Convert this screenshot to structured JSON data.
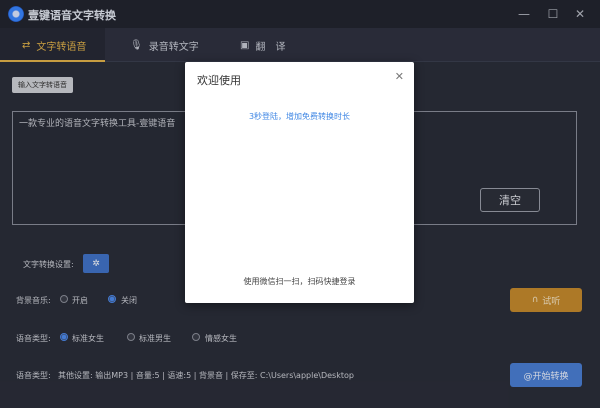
{
  "app": {
    "title": "壹键语音文字转换",
    "logo_icon": "app-logo-icon"
  },
  "window": {
    "minimize_icon": "minimize-icon",
    "maximize_icon": "maximize-icon",
    "close_icon": "close-icon"
  },
  "tabs": [
    {
      "label": "文字转语音",
      "icon": "text-to-speech-icon",
      "active": true
    },
    {
      "label": "录音转文字",
      "icon": "microphone-icon",
      "active": false
    },
    {
      "label": "翻　译",
      "icon": "translate-icon",
      "active": false
    }
  ],
  "editor": {
    "import_button": "输入文字转语音",
    "content": "一款专业的语音文字转换工具-壹键语音",
    "clear_button": "清空"
  },
  "settings": {
    "conversion_label": "文字转换设置:",
    "gear_icon": "gear-icon",
    "bgm_label": "背景音乐:",
    "bgm_on": "开启",
    "bgm_off": "关闭",
    "voice_label": "语音类型:",
    "voice_options": [
      "标准女生",
      "标准男生",
      "情感女生"
    ],
    "voice_selected": 0,
    "summary_label": "语音类型:",
    "summary_text": "其他设置: 输出MP3 | 音量:5 | 语速:5 | 背景音 | 保存至: C:\\Users\\apple\\Desktop"
  },
  "actions": {
    "try_button": "试听",
    "try_icon": "headphones-icon",
    "start_button": "@开始转换"
  },
  "dialog": {
    "title": "欢迎使用",
    "close_icon": "close-icon",
    "login_link": "3秒登陆，增加免费转换时长",
    "tip": "使用微信扫一扫，扫码快捷登录"
  },
  "colors": {
    "accent_gold": "#e3b34a",
    "button_gold": "#c58a2d",
    "button_blue": "#4a7fd4",
    "link_blue": "#3e86e4",
    "background": "#2b2e3a"
  }
}
